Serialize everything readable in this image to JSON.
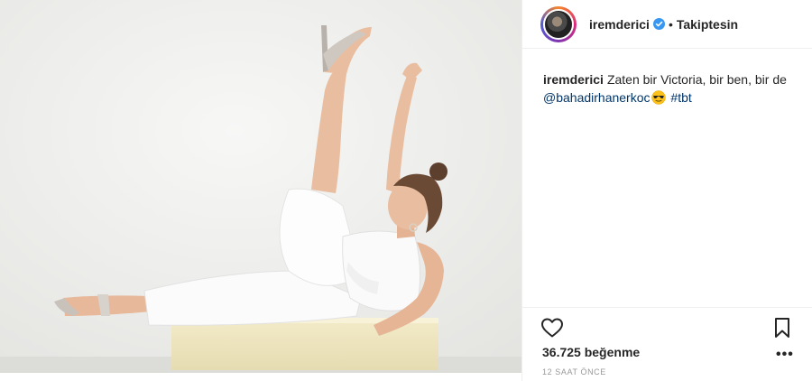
{
  "post": {
    "image": {
      "description_icon": "photo-woman-white-outfit-leg-raised"
    },
    "header": {
      "username": "iremderici",
      "verified_icon": "verified-badge-icon",
      "separator": "•",
      "follow_status": "Takiptesin"
    },
    "caption": {
      "username": "iremderici",
      "text": "Zaten bir Victoria, bir ben, bir de",
      "mention": "@bahadirhanerkoc",
      "emoji": "sunglasses-emoji-icon",
      "hashtag": "#tbt"
    },
    "actions": {
      "like_icon": "heart-icon",
      "save_icon": "bookmark-icon",
      "more_icon": "more-dots-icon",
      "more_glyph": "•••"
    },
    "likes_text": "36.725 beğenme",
    "timestamp": "12 SAAT ÖNCE"
  },
  "colors": {
    "text": "#262626",
    "link": "#003569",
    "muted": "#999999",
    "verified": "#3897f0",
    "divider": "#efefef"
  }
}
